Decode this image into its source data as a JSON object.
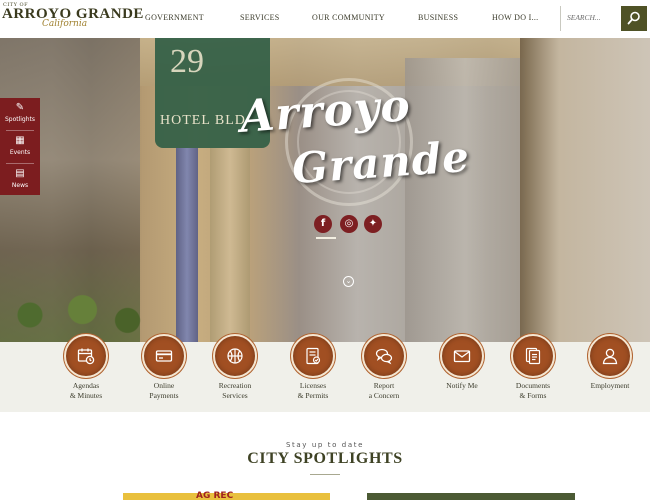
{
  "logo": {
    "small": "CITY OF",
    "main": "ARROYO GRANDE",
    "script": "California"
  },
  "nav": {
    "items": [
      {
        "label": "GOVERNMENT"
      },
      {
        "label": "SERVICES"
      },
      {
        "label": "OUR COMMUNITY"
      },
      {
        "label": "BUSINESS"
      },
      {
        "label": "HOW DO I..."
      }
    ]
  },
  "search": {
    "placeholder": "SEARCH..."
  },
  "hero": {
    "title_line1": "Arroyo",
    "title_line2": "Grande",
    "awning_number": "29",
    "awning_text": "HOTEL BLD"
  },
  "social": [
    {
      "icon": "facebook-icon",
      "glyph": "f"
    },
    {
      "icon": "instagram-icon",
      "glyph": "◎"
    },
    {
      "icon": "twitter-icon",
      "glyph": "✦"
    }
  ],
  "side_tabs": [
    {
      "label": "Spotlights",
      "icon": "spotlight-icon"
    },
    {
      "label": "Events",
      "icon": "calendar-icon"
    },
    {
      "label": "News",
      "icon": "newspaper-icon"
    }
  ],
  "quick_links": [
    {
      "line1": "Agendas",
      "line2": "& Minutes",
      "icon": "calendar-clock-icon"
    },
    {
      "line1": "Online",
      "line2": "Payments",
      "icon": "credit-card-icon"
    },
    {
      "line1": "Recreation",
      "line2": "Services",
      "icon": "basketball-icon"
    },
    {
      "line1": "Licenses",
      "line2": "& Permits",
      "icon": "license-icon"
    },
    {
      "line1": "Report",
      "line2": "a Concern",
      "icon": "chat-bubbles-icon"
    },
    {
      "line1": "Notify Me",
      "line2": "",
      "icon": "envelope-icon"
    },
    {
      "line1": "Documents",
      "line2": "& Forms",
      "icon": "documents-icon"
    },
    {
      "line1": "Employment",
      "line2": "",
      "icon": "person-icon"
    }
  ],
  "spotlights": {
    "kicker": "Stay up to date",
    "title": "CITY SPOTLIGHTS",
    "card_left_text": "AG REC"
  },
  "colors": {
    "brand_olive": "#4f5226",
    "accent_maroon": "#7c1d1f",
    "icon_copper": "#a14f22"
  }
}
